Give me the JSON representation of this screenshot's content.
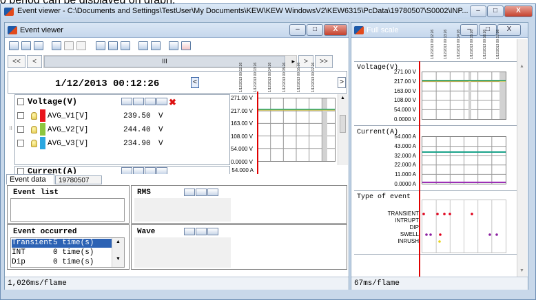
{
  "caption": "o period can be displayed on graph.",
  "app": {
    "title": "Event viewer - C:\\Documents and Settings\\TestUser\\My Documents\\KEW\\KEW WindowsV2\\KEW6315\\PcData\\19780507\\S0002\\INP...",
    "window_buttons": {
      "minimize": "–",
      "maximize": "□",
      "close": "X"
    }
  },
  "event_viewer": {
    "title": "Event viewer",
    "nav": {
      "first": "<<",
      "prev": "<",
      "center": "III",
      "next": ">",
      "last": ">>"
    },
    "datetime": "1/12/2013 00:12:26",
    "tick_labels": [
      "1/12/2013 00:12:26",
      "1/12/2013 00:13:26",
      "1/12/2013 00:14:26",
      "1/12/2013 00:15:26",
      "1/12/2013 00:16:26",
      "1/12/2013 00:17:26"
    ],
    "groups": [
      {
        "name": "Voltage(V)",
        "channels": [
          {
            "label": "AVG_V1[V]",
            "value": "239.50",
            "unit": "V",
            "color": "#e8141c"
          },
          {
            "label": "AVG_V2[V]",
            "value": "244.40",
            "unit": "V",
            "color": "#8cc63f"
          },
          {
            "label": "AVG_V3[V]",
            "value": "234.90",
            "unit": "V",
            "color": "#2aa7e0"
          }
        ],
        "axis": [
          "271.00 V",
          "217.00 V",
          "163.00 V",
          "108.00 V",
          "54.000 V",
          "0.0000 V"
        ]
      },
      {
        "name": "Current(A)",
        "axis_top": "54.000 A"
      }
    ],
    "tabs": [
      "Event data",
      "19780507"
    ],
    "event_list_label": "Event list",
    "rms_label": "RMS",
    "wave_label": "Wave",
    "event_occurred_label": "Event occurred",
    "event_occurred": [
      {
        "type": "Transient",
        "count": "5 time(s)"
      },
      {
        "type": "INT",
        "count": "0 time(s)"
      },
      {
        "type": "Dip",
        "count": "0 time(s)"
      }
    ],
    "status": "1,026ms/flame"
  },
  "full_scale": {
    "title": "Full scale",
    "tick_labels": [
      "1/12/2013 00:12:26",
      "1/12/2013 00:13:26",
      "1/12/2013 00:14:26",
      "1/12/2013 00:15:26",
      "1/12/2013 00:16:26",
      "1/12/2013 00:17:26"
    ],
    "voltage": {
      "name": "Voltage(V)",
      "axis": [
        "271.00 V",
        "217.00 V",
        "163.00 V",
        "108.00 V",
        "54.000 V",
        "0.0000 V"
      ]
    },
    "current": {
      "name": "Current(A)",
      "axis": [
        "54.000 A",
        "43.000 A",
        "32.000 A",
        "22.000 A",
        "11.000 A",
        "0.0000 A"
      ]
    },
    "events": {
      "name": "Type of event",
      "types": [
        "TRANSIENT",
        "INTRUPT",
        "DIP",
        "SWELL",
        "INRUSH"
      ]
    },
    "status": "67ms/flame"
  },
  "colors": {
    "accent": "#2c62b4",
    "cursor": "#e00000",
    "voltage_trace": "#1aa38a",
    "current_trace": "#1aa38a",
    "current_base": "#9b2fb5",
    "event_marker": "#e0001a",
    "swell_marker": "#8b1fa0",
    "inrush_marker": "#e9d51a"
  }
}
